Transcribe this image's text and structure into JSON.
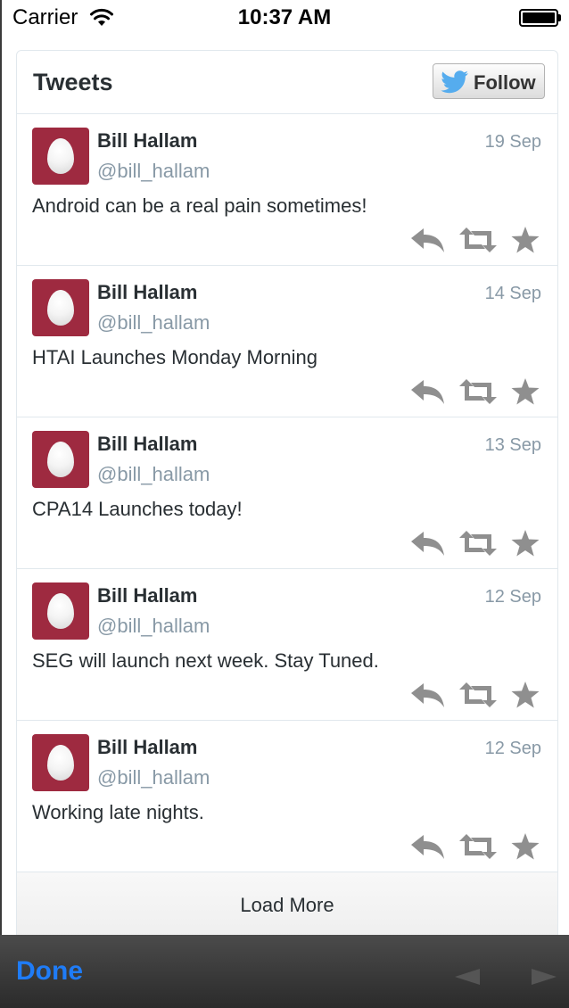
{
  "status_bar": {
    "carrier": "Carrier",
    "time": "10:37 AM"
  },
  "widget": {
    "title": "Tweets",
    "follow_label": "Follow",
    "load_more": "Load More",
    "tweets": [
      {
        "author": "Bill Hallam",
        "handle": "@bill_hallam",
        "date": "19 Sep",
        "text": "Android can be a real pain sometimes!"
      },
      {
        "author": "Bill Hallam",
        "handle": "@bill_hallam",
        "date": "14 Sep",
        "text": "HTAI Launches Monday Morning"
      },
      {
        "author": "Bill Hallam",
        "handle": "@bill_hallam",
        "date": "13 Sep",
        "text": "CPA14 Launches today!"
      },
      {
        "author": "Bill Hallam",
        "handle": "@bill_hallam",
        "date": "12 Sep",
        "text": "SEG will launch next week. Stay Tuned."
      },
      {
        "author": "Bill Hallam",
        "handle": "@bill_hallam",
        "date": "12 Sep",
        "text": "Working late nights."
      }
    ]
  },
  "toolbar": {
    "done_label": "Done"
  },
  "colors": {
    "accent": "#1f7cf7",
    "avatar_bg": "#9e2a40",
    "twitter_blue": "#55acee",
    "action_gray": "#8f8f8f"
  },
  "icons": [
    "wifi-icon",
    "battery-icon",
    "twitter-bird-icon",
    "reply-icon",
    "retweet-icon",
    "favorite-icon",
    "back-arrow-icon",
    "forward-arrow-icon"
  ]
}
